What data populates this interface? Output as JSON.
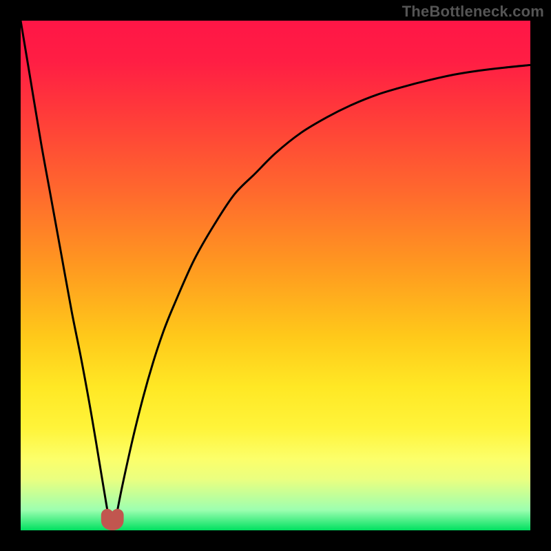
{
  "watermark": "TheBottleneck.com",
  "chart_data": {
    "type": "line",
    "title": "",
    "xlabel": "",
    "ylabel": "",
    "xlim": [
      0,
      100
    ],
    "ylim": [
      0,
      100
    ],
    "series": [
      {
        "name": "bottleneck-curve",
        "x": [
          0,
          2,
          4,
          6,
          8,
          10,
          12,
          14,
          16,
          17,
          17.5,
          18,
          18.5,
          19,
          20,
          22,
          24,
          26,
          28,
          30,
          34,
          38,
          42,
          46,
          50,
          55,
          60,
          65,
          70,
          75,
          80,
          85,
          90,
          95,
          100
        ],
        "values": [
          100,
          88,
          76,
          65,
          54,
          43,
          33,
          22,
          10,
          4,
          1.5,
          0.5,
          1.5,
          4,
          9,
          18,
          26,
          33,
          39,
          44,
          53,
          60,
          66,
          70,
          74,
          78,
          81,
          83.5,
          85.5,
          87,
          88.3,
          89.4,
          90.2,
          90.8,
          91.3
        ]
      }
    ],
    "marker_region": {
      "x_start": 17,
      "x_end": 19,
      "height": 3
    },
    "gradient_stops_pct": [
      0,
      8,
      18,
      34,
      48,
      62,
      72,
      80,
      86,
      90,
      96,
      100
    ],
    "gradient_colors": [
      "#ff1646",
      "#ff1e44",
      "#ff3a3a",
      "#ff6a2d",
      "#ff9820",
      "#ffc91a",
      "#ffe825",
      "#fff43a",
      "#fcff6a",
      "#eaff80",
      "#9dffb0",
      "#00e060"
    ]
  }
}
